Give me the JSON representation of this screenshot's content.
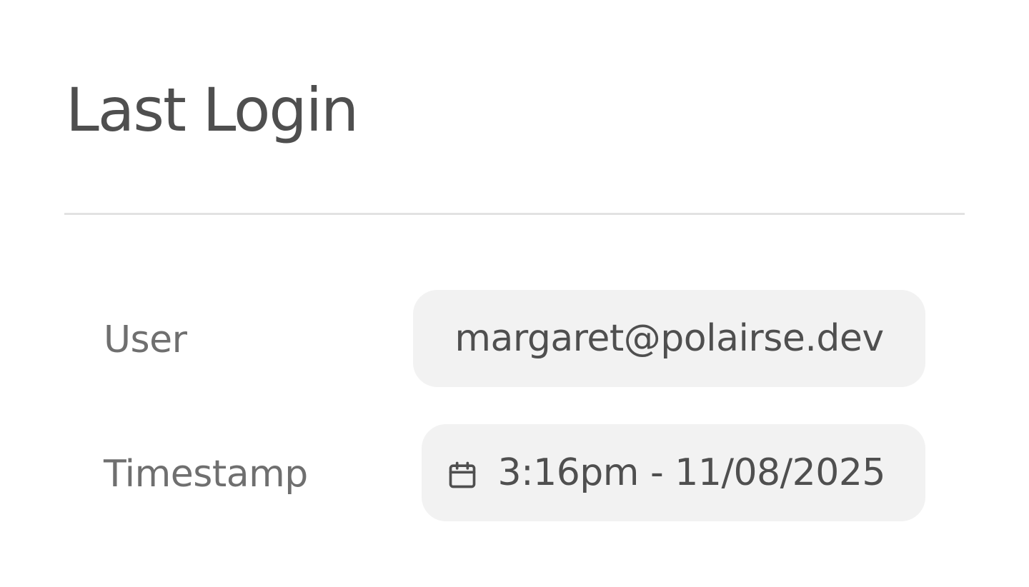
{
  "header": {
    "title": "Last Login"
  },
  "rows": [
    {
      "label": "User",
      "value": "margaret@polairse.dev"
    },
    {
      "label": "Timestamp",
      "value": "3:16pm - 11/08/2025",
      "icon": "calendar-icon"
    }
  ],
  "colors": {
    "text": "#4f4f4f",
    "label": "#6f6f6f",
    "pill_bg": "#f2f2f2",
    "divider": "#e2e2e2"
  }
}
